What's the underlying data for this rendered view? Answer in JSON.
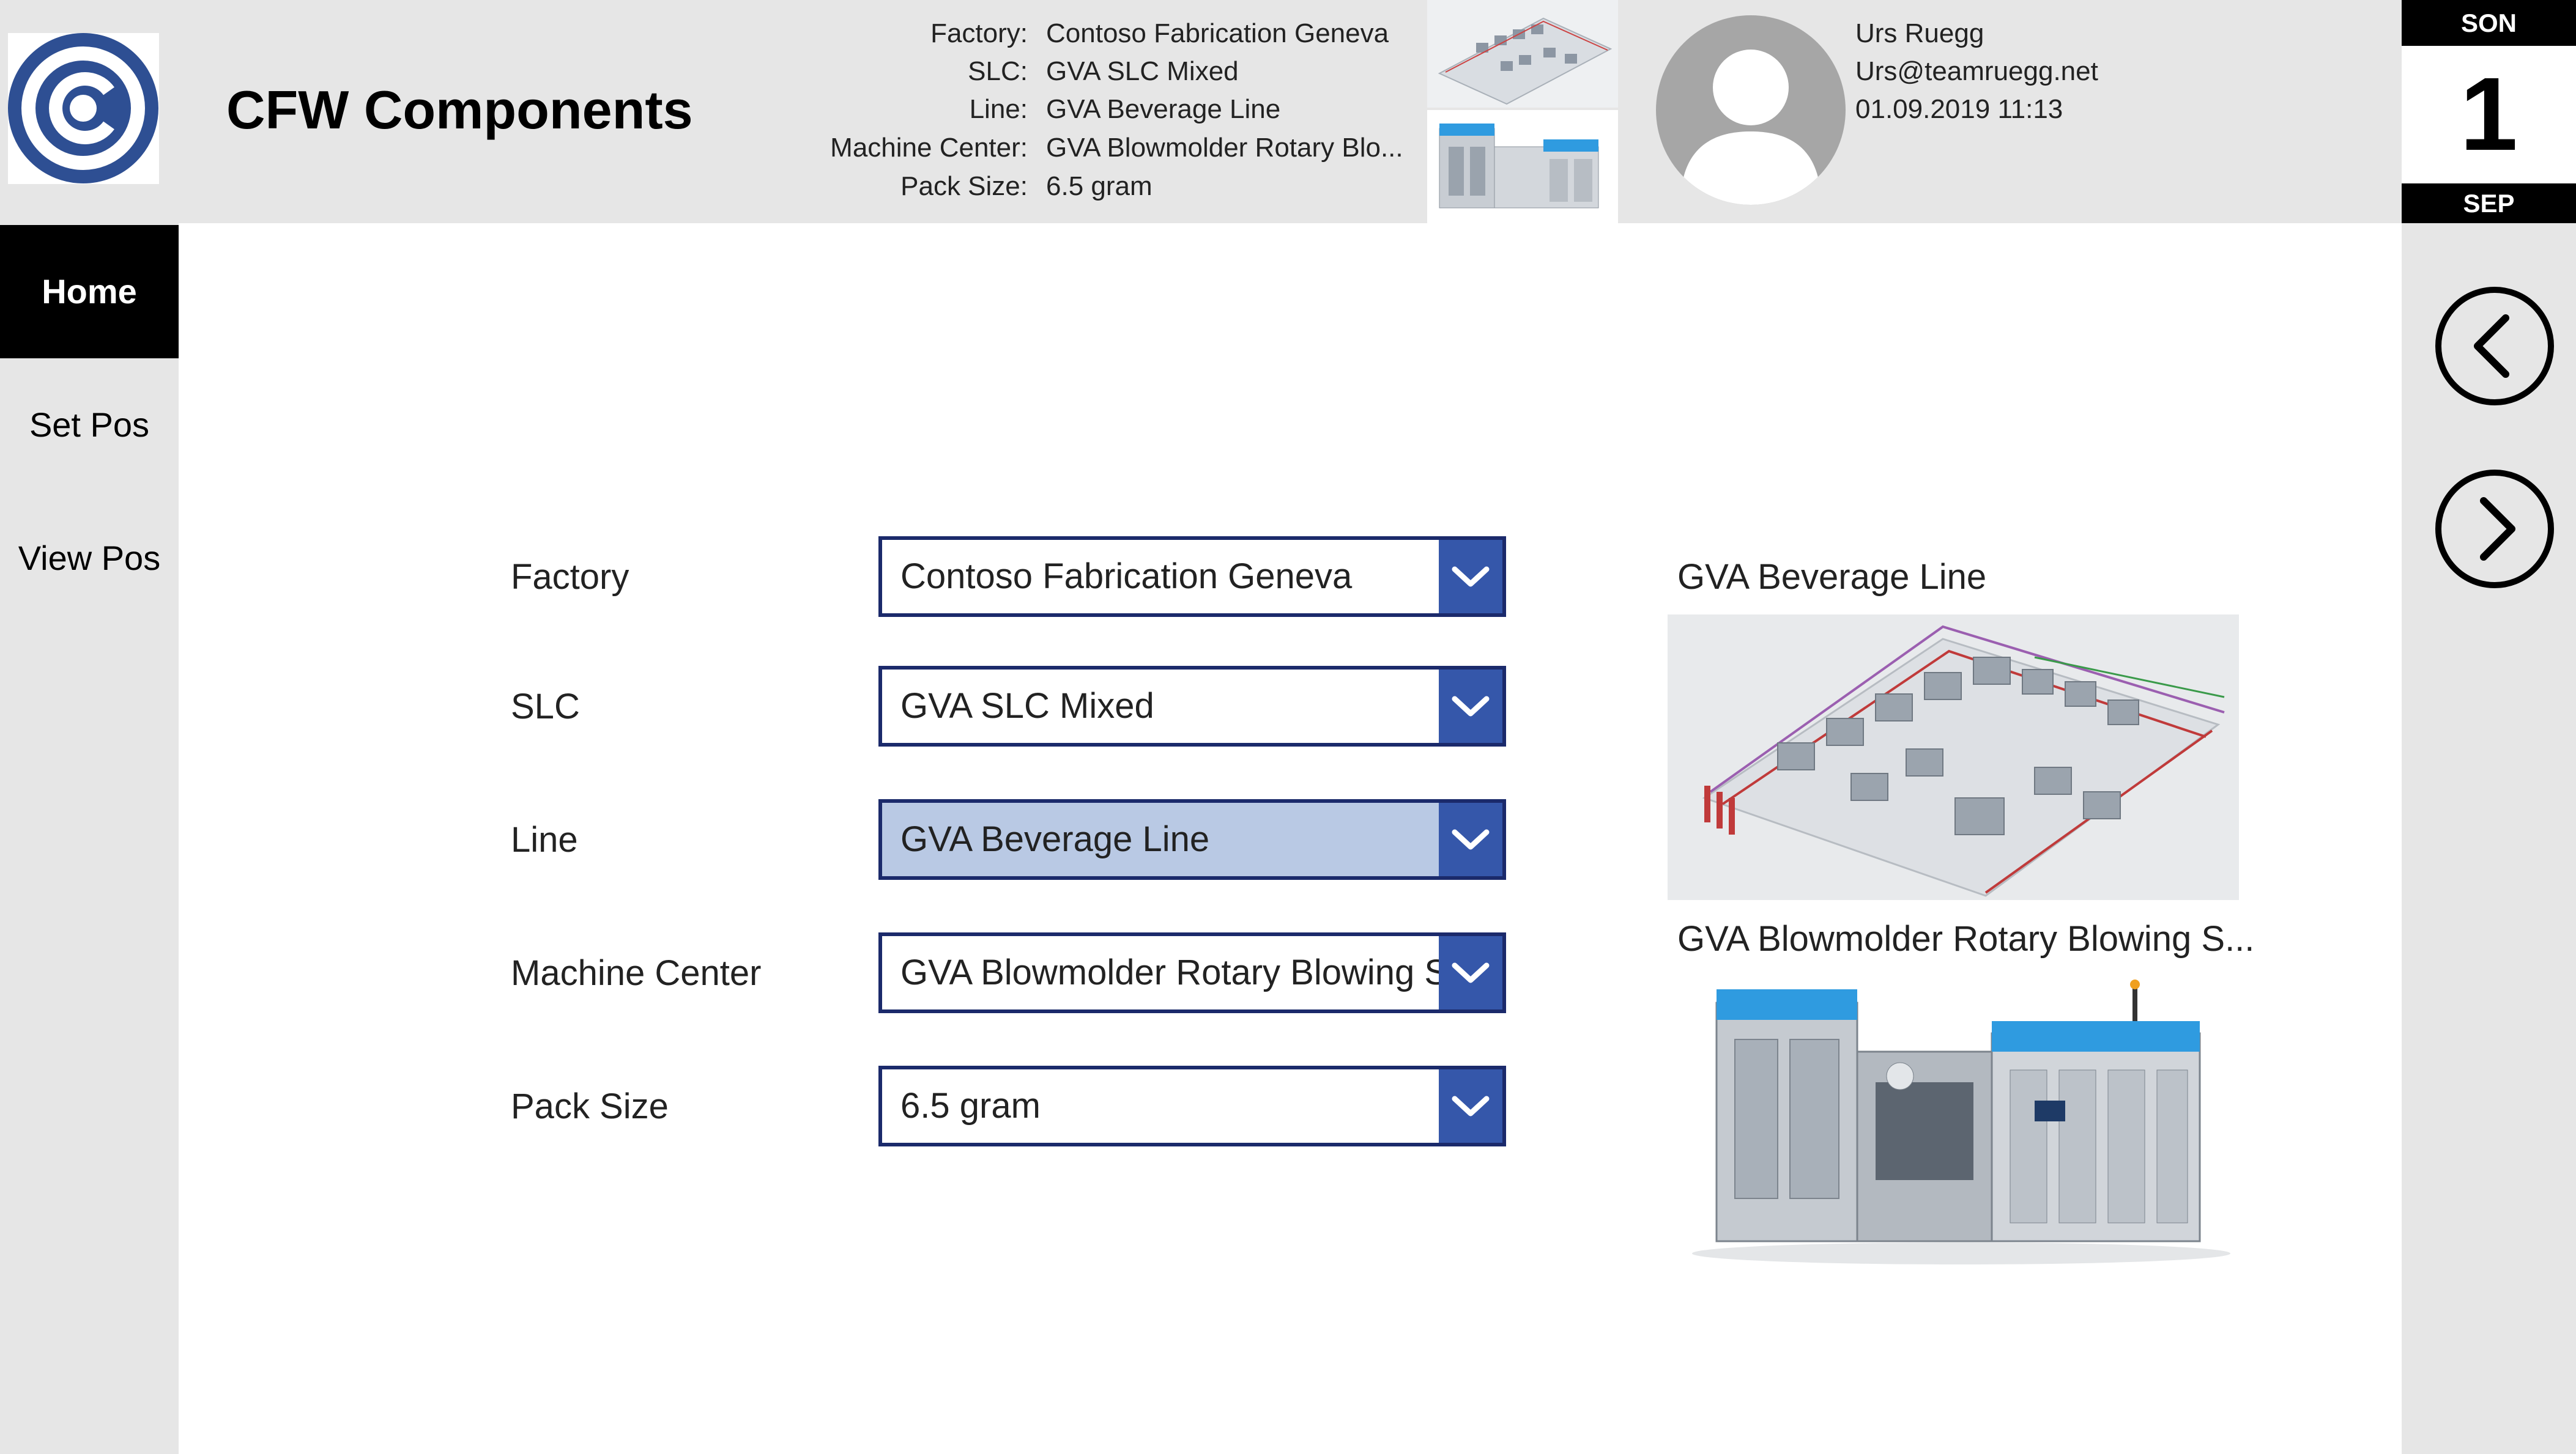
{
  "header": {
    "title": "CFW Components",
    "context": [
      {
        "label": "Factory:",
        "value": "Contoso Fabrication Geneva"
      },
      {
        "label": "SLC:",
        "value": "GVA SLC Mixed"
      },
      {
        "label": "Line:",
        "value": "GVA Beverage Line"
      },
      {
        "label": "Machine Center:",
        "value": "GVA Blowmolder Rotary Blo..."
      },
      {
        "label": "Pack Size:",
        "value": "6.5 gram"
      }
    ],
    "user": {
      "name": "Urs Ruegg",
      "email": "Urs@teamruegg.net",
      "datetime": "01.09.2019 11:13"
    },
    "logo_icon": "contoso-c-logo-icon",
    "avatar_icon": "user-silhouette-icon"
  },
  "date_tile": {
    "day_name": "SON",
    "day_number": "1",
    "month": "SEP"
  },
  "nav_buttons": {
    "back_icon": "chevron-left-circle-icon",
    "forward_icon": "chevron-right-circle-icon"
  },
  "sidebar": {
    "items": [
      {
        "label": "Home",
        "active": true
      },
      {
        "label": "Set Pos",
        "active": false
      },
      {
        "label": "View Pos",
        "active": false
      }
    ]
  },
  "form": {
    "fields": [
      {
        "label": "Factory",
        "value": "Contoso Fabrication Geneva"
      },
      {
        "label": "SLC",
        "value": "GVA SLC Mixed"
      },
      {
        "label": "Line",
        "value": "GVA Beverage Line"
      },
      {
        "label": "Machine Center",
        "value": "GVA Blowmolder Rotary Blowing Sy"
      },
      {
        "label": "Pack Size",
        "value": "6.5 gram"
      }
    ]
  },
  "images": {
    "line_caption": "GVA Beverage Line",
    "machine_caption": "GVA Blowmolder Rotary Blowing S..."
  },
  "colors": {
    "header_bg": "#e6e6e6",
    "dropdown_border": "#1b2a6b",
    "dropdown_chevron_bg": "#3557aa",
    "selected_dropdown_bg": "#b9c9e4",
    "logo_blue": "#2e4f93"
  }
}
